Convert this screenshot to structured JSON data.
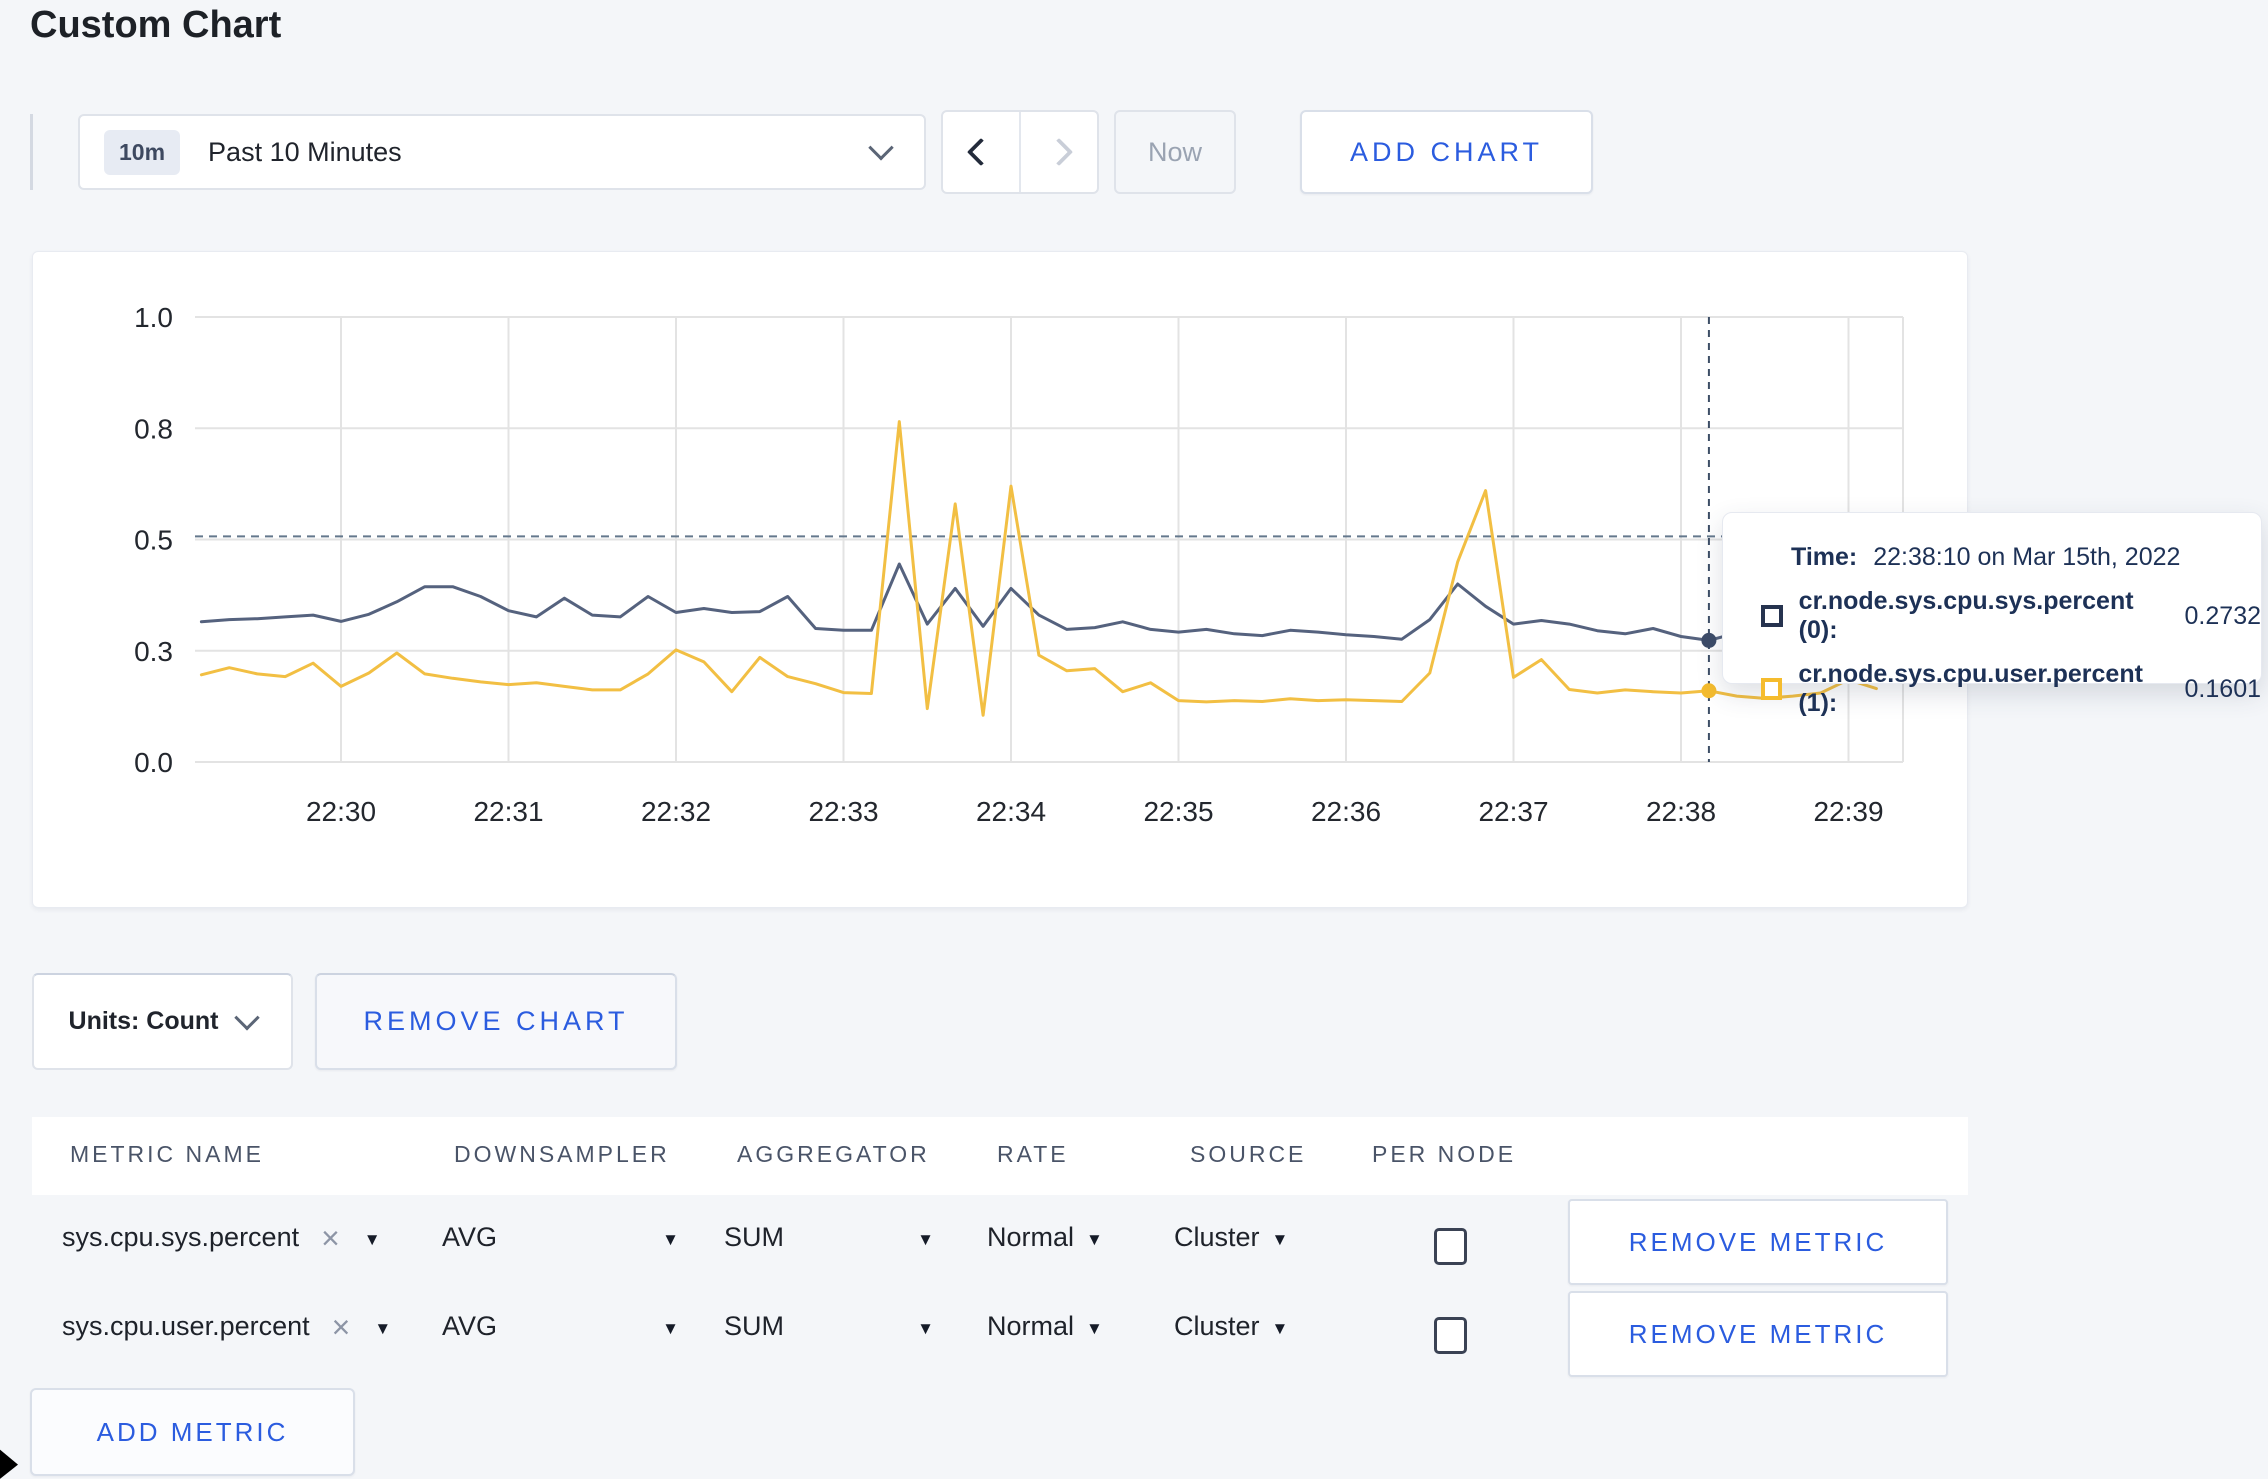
{
  "page": {
    "title": "Custom Chart"
  },
  "toolbar": {
    "time_badge": "10m",
    "time_label": "Past 10 Minutes",
    "now_label": "Now",
    "add_chart_label": "ADD CHART"
  },
  "chart_controls": {
    "units_label": "Units: Count",
    "remove_chart_label": "REMOVE CHART"
  },
  "tooltip": {
    "time_label": "Time:",
    "time_value": "22:38:10 on Mar 15th, 2022",
    "series": [
      {
        "swatch_color": "#26334f",
        "name": "cr.node.sys.cpu.sys.percent (0):",
        "value": "0.2732"
      },
      {
        "swatch_color": "#f5bc2e",
        "name": "cr.node.sys.cpu.user.percent (1):",
        "value": "0.1601"
      }
    ]
  },
  "metrics_table": {
    "headers": [
      "METRIC NAME",
      "DOWNSAMPLER",
      "AGGREGATOR",
      "RATE",
      "SOURCE",
      "PER NODE"
    ],
    "rows": [
      {
        "metric": "sys.cpu.sys.percent",
        "downsampler": "AVG",
        "aggregator": "SUM",
        "rate": "Normal",
        "source": "Cluster",
        "per_node_checked": false,
        "remove_label": "REMOVE METRIC"
      },
      {
        "metric": "sys.cpu.user.percent",
        "downsampler": "AVG",
        "aggregator": "SUM",
        "rate": "Normal",
        "source": "Cluster",
        "per_node_checked": false,
        "remove_label": "REMOVE METRIC"
      }
    ],
    "add_metric_label": "ADD METRIC"
  },
  "chart_data": {
    "type": "line",
    "title": "",
    "grid": true,
    "legend": false,
    "x_axis": {
      "tick_labels": [
        "22:30",
        "22:31",
        "22:32",
        "22:33",
        "22:34",
        "22:35",
        "22:36",
        "22:37",
        "22:38",
        "22:39"
      ],
      "tick_interval_seconds": 60
    },
    "y_axis": {
      "tick_labels": [
        "0.0",
        "0.3",
        "0.5",
        "0.8",
        "1.0"
      ],
      "tick_values": [
        0,
        0.25,
        0.5,
        0.75,
        1.0
      ],
      "range": [
        0,
        1
      ]
    },
    "sample_interval_seconds": 10,
    "start_offset_seconds_from_2230": -50,
    "series": [
      {
        "name": "cr.node.sys.cpu.sys.percent",
        "color": "#55627e",
        "values": [
          0.315,
          0.32,
          0.322,
          0.326,
          0.33,
          0.316,
          0.332,
          0.36,
          0.394,
          0.394,
          0.372,
          0.34,
          0.326,
          0.368,
          0.33,
          0.326,
          0.372,
          0.336,
          0.345,
          0.336,
          0.338,
          0.372,
          0.3,
          0.296,
          0.296,
          0.445,
          0.31,
          0.39,
          0.305,
          0.39,
          0.33,
          0.298,
          0.302,
          0.315,
          0.298,
          0.292,
          0.298,
          0.288,
          0.284,
          0.296,
          0.292,
          0.286,
          0.282,
          0.276,
          0.32,
          0.4,
          0.35,
          0.31,
          0.318,
          0.31,
          0.295,
          0.288,
          0.3,
          0.282,
          0.2732,
          0.29,
          0.296,
          0.288,
          0.296,
          0.31,
          0.298
        ]
      },
      {
        "name": "cr.node.sys.cpu.user.percent",
        "color": "#f2bf43",
        "values": [
          0.196,
          0.212,
          0.198,
          0.192,
          0.222,
          0.17,
          0.2,
          0.245,
          0.198,
          0.188,
          0.18,
          0.174,
          0.178,
          0.17,
          0.162,
          0.162,
          0.198,
          0.252,
          0.225,
          0.158,
          0.235,
          0.192,
          0.176,
          0.156,
          0.154,
          0.765,
          0.12,
          0.58,
          0.105,
          0.62,
          0.24,
          0.205,
          0.21,
          0.158,
          0.178,
          0.138,
          0.135,
          0.138,
          0.136,
          0.142,
          0.138,
          0.14,
          0.138,
          0.136,
          0.2,
          0.45,
          0.61,
          0.19,
          0.23,
          0.163,
          0.155,
          0.162,
          0.158,
          0.155,
          0.1601,
          0.148,
          0.143,
          0.148,
          0.155,
          0.185,
          0.165
        ]
      }
    ],
    "reference_line_value": 0.507,
    "crosshair": {
      "time": "22:38:10",
      "seconds_after_2230": 490,
      "values": [
        0.2732,
        0.1601
      ]
    }
  }
}
